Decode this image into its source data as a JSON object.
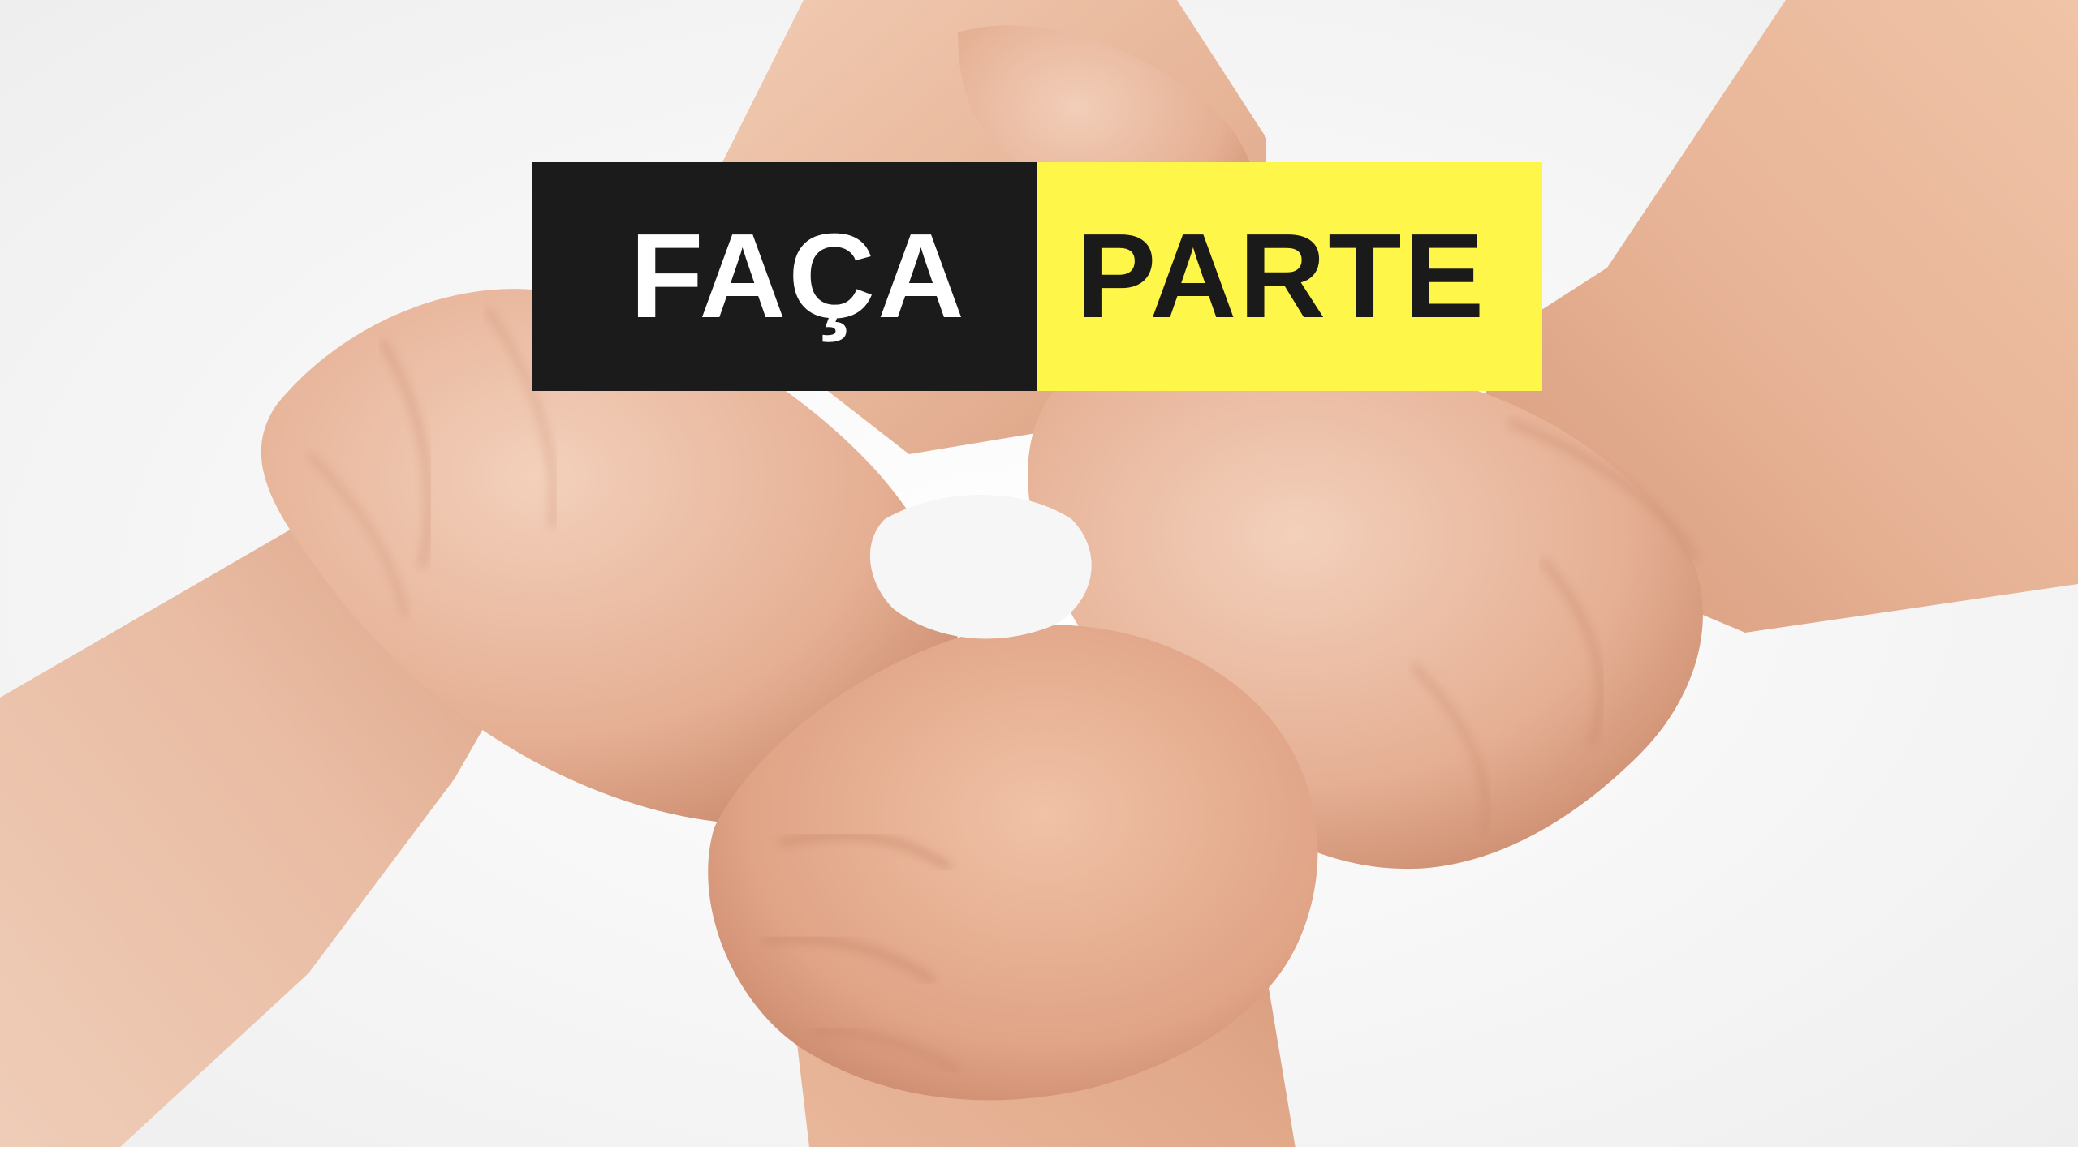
{
  "banner": {
    "left_text": "FAÇA",
    "right_text": "PARTE"
  },
  "colors": {
    "left_bg": "#1b1b1b",
    "left_fg": "#ffffff",
    "right_bg": "#fff64a",
    "right_fg": "#1a1a1a",
    "skin_light": "#f0c7ad",
    "skin_mid": "#e0a98c",
    "skin_shadow": "#c98a6e",
    "background": "#f4f4f4"
  },
  "photo": {
    "subject": "four-hands-linked-wrists"
  }
}
